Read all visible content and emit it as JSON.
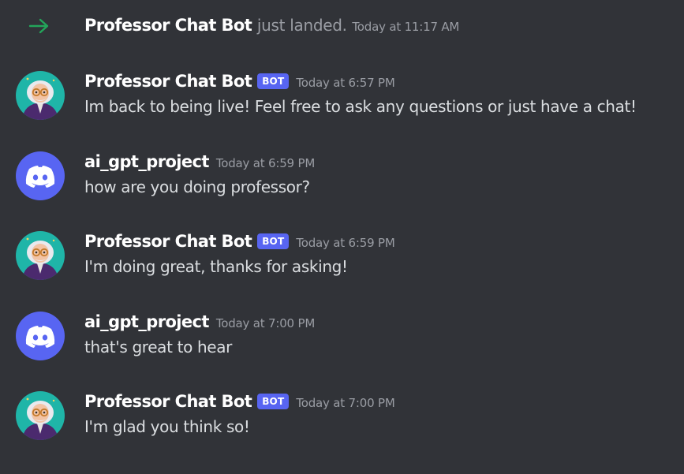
{
  "join_event": {
    "username": "Professor Chat Bot",
    "action_text": "just landed.",
    "timestamp": "Today at 11:17 AM"
  },
  "bot_tag": "BOT",
  "messages": [
    {
      "author": "Professor Chat Bot",
      "is_bot": true,
      "avatar": "professor-avatar",
      "timestamp": "Today at 6:57 PM",
      "content": "Im back to being live! Feel free to ask any questions or just have a chat!"
    },
    {
      "author": "ai_gpt_project",
      "is_bot": false,
      "avatar": "discord-default-avatar",
      "timestamp": "Today at 6:59 PM",
      "content": "how are you doing professor?"
    },
    {
      "author": "Professor Chat Bot",
      "is_bot": true,
      "avatar": "professor-avatar",
      "timestamp": "Today at 6:59 PM",
      "content": "I'm doing great, thanks for asking!"
    },
    {
      "author": "ai_gpt_project",
      "is_bot": false,
      "avatar": "discord-default-avatar",
      "timestamp": "Today at 7:00 PM",
      "content": "that's great to hear"
    },
    {
      "author": "Professor Chat Bot",
      "is_bot": true,
      "avatar": "professor-avatar",
      "timestamp": "Today at 7:00 PM",
      "content": "I'm glad you think so!"
    }
  ],
  "colors": {
    "background": "#313338",
    "join_arrow": "#23a55a",
    "bot_tag": "#5865f2",
    "discord_avatar": "#5865f2",
    "professor_avatar_bg": "#1fb5a8"
  }
}
